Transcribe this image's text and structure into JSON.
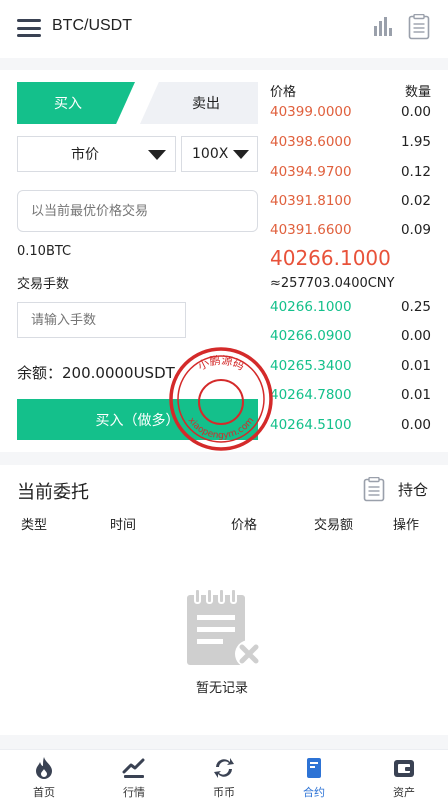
{
  "header": {
    "title": "BTC/USDT",
    "menu_icon": "hamburger-icon",
    "chart_icon": "bar-chart-icon",
    "doc_icon": "document-icon"
  },
  "trade": {
    "tabs": {
      "buy": "买入",
      "sell": "卖出"
    },
    "order_type": {
      "value": "市价"
    },
    "leverage": {
      "value": "100X"
    },
    "price_input": {
      "placeholder": "以当前最优价格交易"
    },
    "amount_text": "0.10BTC",
    "fee_label": "交易手数",
    "qty_input": {
      "placeholder": "请输入手数"
    },
    "balance": "余额：200.0000USDT",
    "buy_button": "买入（做多）"
  },
  "orderbook": {
    "price_header": "价格",
    "qty_header": "数量",
    "asks": [
      {
        "price": "40399.0000",
        "qty": "0.00"
      },
      {
        "price": "40398.6000",
        "qty": "1.95"
      },
      {
        "price": "40394.9700",
        "qty": "0.12"
      },
      {
        "price": "40391.8100",
        "qty": "0.02"
      },
      {
        "price": "40391.6600",
        "qty": "0.09"
      }
    ],
    "last_price": "40266.1000",
    "cny_price": "≈257703.0400CNY",
    "bids": [
      {
        "price": "40266.1000",
        "qty": "0.25"
      },
      {
        "price": "40266.0900",
        "qty": "0.00"
      },
      {
        "price": "40265.3400",
        "qty": "0.01"
      },
      {
        "price": "40264.7800",
        "qty": "0.01"
      },
      {
        "price": "40264.5100",
        "qty": "0.00"
      }
    ]
  },
  "orders": {
    "title": "当前委托",
    "position_link": "持仓",
    "columns": [
      "类型",
      "时间",
      "价格",
      "交易额",
      "操作"
    ],
    "empty_text": "暂无记录"
  },
  "tabbar": [
    {
      "label": "首页",
      "icon": "flame-icon"
    },
    {
      "label": "行情",
      "icon": "trend-icon"
    },
    {
      "label": "币币",
      "icon": "exchange-icon"
    },
    {
      "label": "合约",
      "icon": "contract-icon"
    },
    {
      "label": "资产",
      "icon": "wallet-icon"
    }
  ],
  "watermark": {
    "top_text": "小鹏源码",
    "bottom_text": "xiaopengym.com"
  },
  "colors": {
    "accent_green": "#14c08b",
    "ask_red": "#e0603d",
    "last_price_red": "#e8523a",
    "active_tab_blue": "#2d73d5"
  }
}
